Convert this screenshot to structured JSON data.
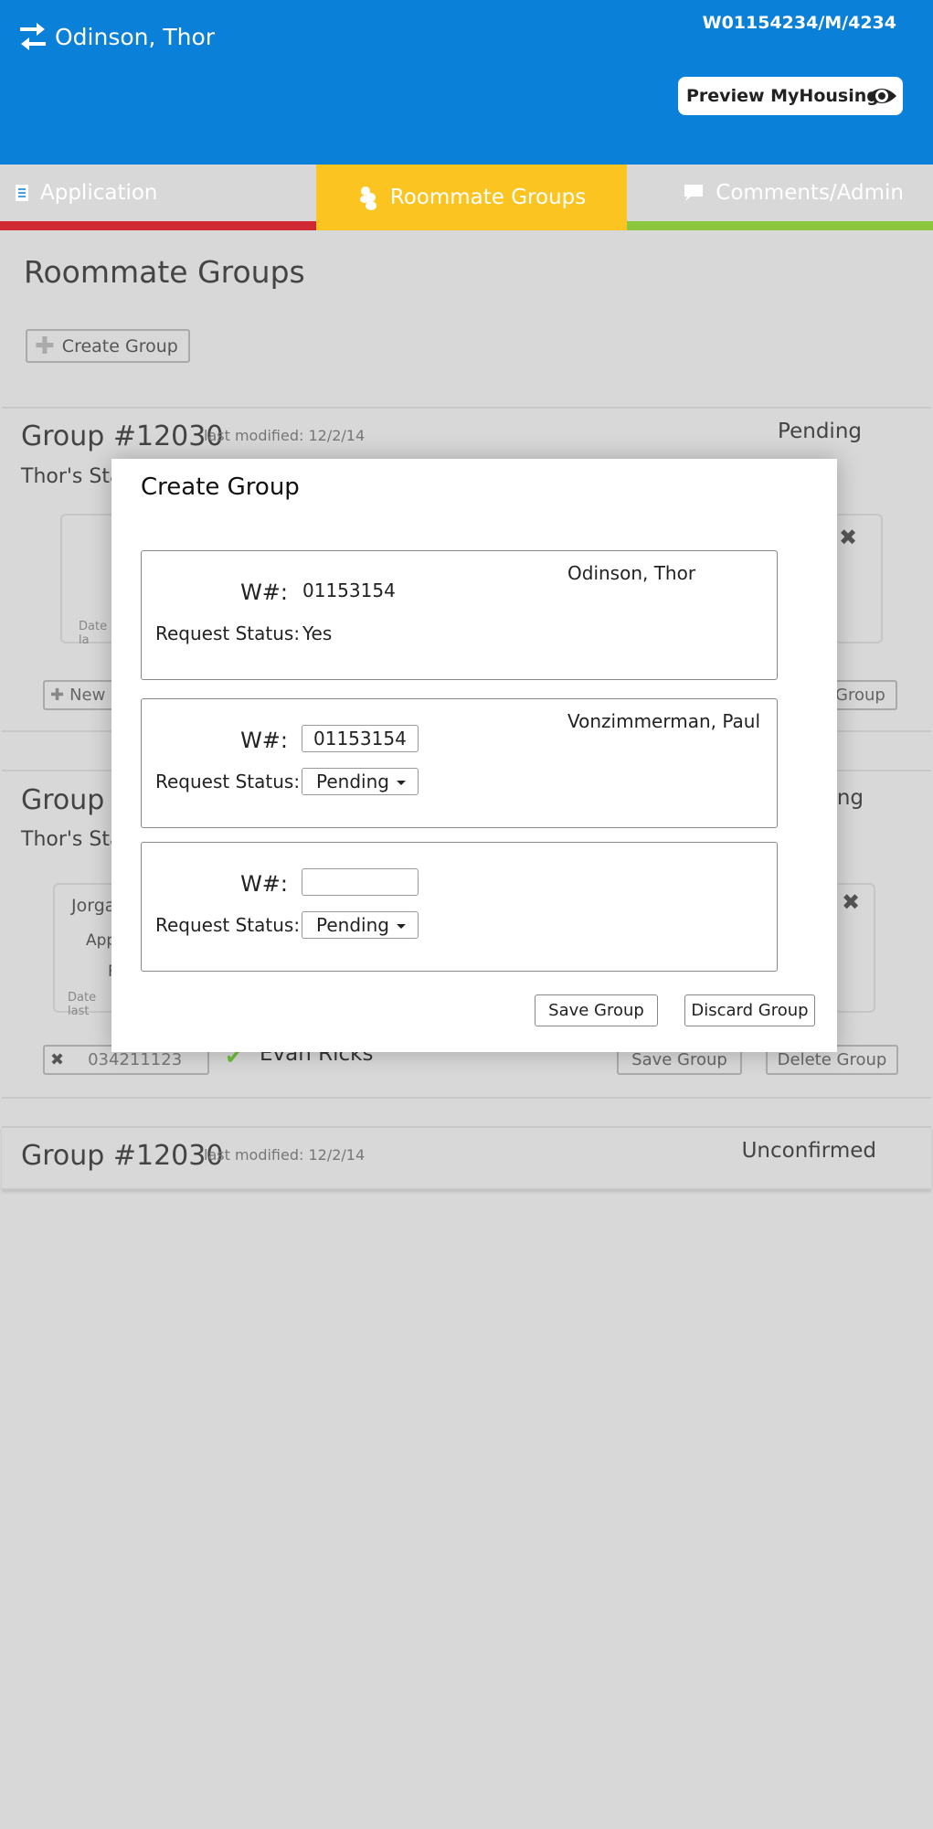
{
  "header": {
    "user_name": "Odinson, Thor",
    "user_id": "W01154234/M/4234",
    "preview_label": "Preview MyHousing"
  },
  "tabs": [
    {
      "label": "Application",
      "color": "#cf2a33"
    },
    {
      "label": "Roommate Groups",
      "color": "#fcc420",
      "active": true
    },
    {
      "label": "Comments/Admin",
      "color": "#8cc63e"
    }
  ],
  "colors": {
    "header": "#0a80d8",
    "background": "#d8d8d8"
  },
  "page": {
    "title": "Roommate Groups",
    "create_group_label": "Create Group"
  },
  "groups": [
    {
      "title": "Group #12030",
      "modified": "last modified: 12/2/14",
      "status": "Pending",
      "status_line": "Thor's Sta",
      "member_date": "Date la",
      "new_label": "New",
      "save_partial": "Group"
    },
    {
      "title": "Group #",
      "status_partial": "ng",
      "status_line": "Thor's Sta",
      "member_name": "Jorga",
      "member_app": "App",
      "member_r": "R",
      "member_date": "Date last",
      "w_number": "034211123",
      "member_check_name": "Evan Ricks",
      "save_label": "Save Group",
      "delete_label": "Delete Group"
    },
    {
      "title": "Group #12030",
      "modified": "last modified: 12/2/14",
      "status": "Unconfirmed"
    }
  ],
  "modal": {
    "title": "Create Group",
    "w_label": "W#:",
    "status_label": "Request Status:",
    "members": [
      {
        "w_number": "01153154",
        "status": "Yes",
        "name": "Odinson, Thor",
        "editable": false
      },
      {
        "w_number": "01153154",
        "status": "Pending",
        "name": "Vonzimmerman, Paul",
        "editable": true
      },
      {
        "w_number": "",
        "status": "Pending",
        "name": "",
        "editable": true
      }
    ],
    "save_label": "Save Group",
    "discard_label": "Discard Group"
  }
}
